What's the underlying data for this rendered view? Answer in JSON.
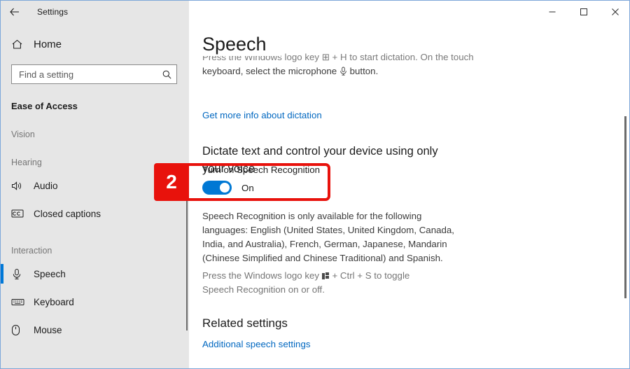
{
  "window": {
    "app_title": "Settings",
    "back_icon": "back-arrow-icon",
    "minimize_label": "Minimize",
    "maximize_label": "Maximize",
    "close_label": "Close"
  },
  "sidebar": {
    "home": {
      "label": "Home",
      "icon": "home-icon"
    },
    "search": {
      "placeholder": "Find a setting",
      "value": "",
      "icon": "search-icon"
    },
    "section_title": "Ease of Access",
    "groups": [
      {
        "label": "Vision",
        "items": []
      },
      {
        "label": "Hearing",
        "items": [
          {
            "label": "Audio",
            "icon": "speaker-icon",
            "selected": false
          },
          {
            "label": "Closed captions",
            "icon": "closed-captions-icon",
            "selected": false
          }
        ]
      },
      {
        "label": "Interaction",
        "items": [
          {
            "label": "Speech",
            "icon": "microphone-icon",
            "selected": true
          },
          {
            "label": "Keyboard",
            "icon": "keyboard-icon",
            "selected": false
          },
          {
            "label": "Mouse",
            "icon": "mouse-icon",
            "selected": false
          }
        ]
      }
    ]
  },
  "main": {
    "page_title": "Speech",
    "dictation_text_clipped": "Press the Windows logo key ⊞ + H to start dictation. On the touch",
    "dictation_text_line2_a": "keyboard, select the microphone",
    "dictation_text_line2_b": "button.",
    "dictation_link": "Get more info about dictation",
    "subhead": "Dictate text and control your device using only your voice",
    "toggle": {
      "label": "Turn on Speech Recognition",
      "state": "On",
      "checked": true,
      "accent_color": "#0078d4"
    },
    "languages_text": "Speech Recognition is only available for the following languages: English (United States, United Kingdom, Canada, India, and Australia), French, German, Japanese, Mandarin (Chinese Simplified and Chinese Traditional) and Spanish.",
    "shortcut_text_a": "Press the Windows logo key",
    "shortcut_text_b": "+ Ctrl + S to toggle Speech Recognition on or off.",
    "related_heading": "Related settings",
    "related_link": "Additional speech settings"
  },
  "annotation": {
    "badge_number": "2",
    "color": "#e8120c"
  }
}
